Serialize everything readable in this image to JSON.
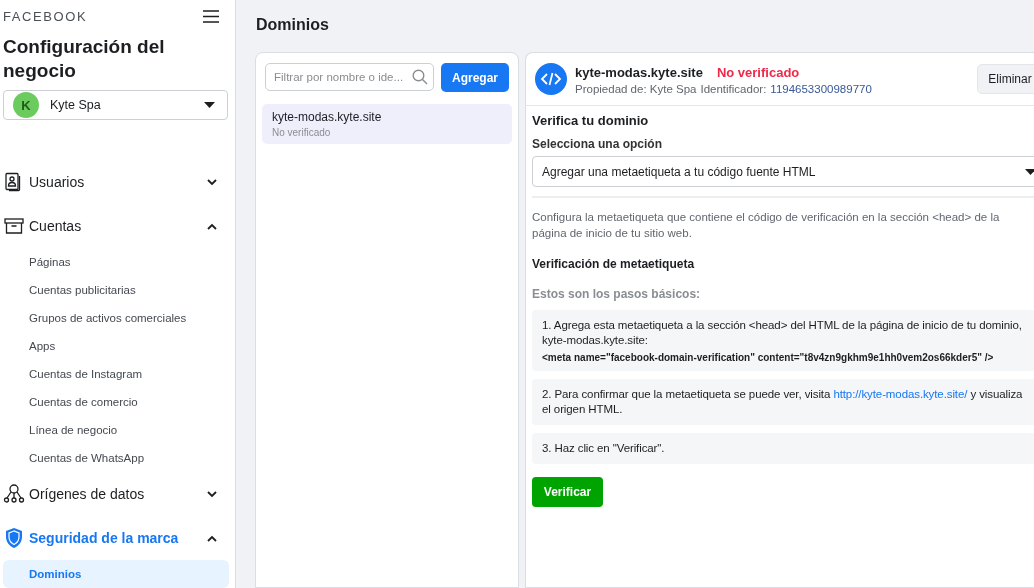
{
  "sidebar": {
    "brand": "FACEBOOK",
    "title": "Configuración del negocio",
    "business": {
      "initial": "K",
      "name": "Kyte Spa"
    },
    "sections": [
      {
        "label": "Usuarios",
        "expanded": false,
        "selected": false
      },
      {
        "label": "Cuentas",
        "expanded": true,
        "selected": false,
        "children": [
          {
            "label": "Páginas",
            "selected": false
          },
          {
            "label": "Cuentas publicitarias",
            "selected": false
          },
          {
            "label": "Grupos de activos comerciales",
            "selected": false
          },
          {
            "label": "Apps",
            "selected": false
          },
          {
            "label": "Cuentas de Instagram",
            "selected": false
          },
          {
            "label": "Cuentas de comercio",
            "selected": false
          },
          {
            "label": "Línea de negocio",
            "selected": false
          },
          {
            "label": "Cuentas de WhatsApp",
            "selected": false
          }
        ]
      },
      {
        "label": "Orígenes de datos",
        "expanded": false,
        "selected": false
      },
      {
        "label": "Seguridad de la marca",
        "expanded": true,
        "selected": true,
        "children": [
          {
            "label": "Dominios",
            "selected": true
          }
        ]
      }
    ]
  },
  "page_title": "Dominios",
  "domain_list": {
    "search": {
      "placeholder": "Filtrar por nombre o ide..."
    },
    "add_button": "Agregar",
    "items": [
      {
        "name": "kyte-modas.kyte.site",
        "status": "No verificado",
        "selected": true
      }
    ]
  },
  "detail": {
    "domain": "kyte-modas.kyte.site",
    "status": "No verificado",
    "verified": false,
    "owner": "Propiedad de: Kyte Spa",
    "id_label": "Identificador:",
    "id": "1194653300989770",
    "delete_button": "Eliminar",
    "heading": "Verifica tu dominio",
    "select_label": "Selecciona una opción",
    "select_value": "Agregar una metaetiqueta a tu código fuente HTML",
    "description": "Configura la metaetiqueta que contiene el código de verificación en la sección <head> de la página de inicio de tu sitio web.",
    "subheading": "Verificación de metaetiqueta",
    "steps_intro": "Estos son los pasos básicos:",
    "steps": [
      {
        "text": "1. Agrega esta metaetiqueta a la sección <head> del HTML de la página de inicio de tu dominio, kyte-modas.kyte.site:",
        "code": "<meta name=\"facebook-domain-verification\" content=\"t8v4zn9gkhm9e1hh0vem2os66kder5\" />"
      },
      {
        "text": "2. Para confirmar que la metaetiqueta se puede ver, visita",
        "link": "http://kyte-modas.kyte.site/",
        "text_after": "y visualiza el origen HTML."
      },
      {
        "text": "3. Haz clic en \"Verificar\"."
      }
    ],
    "verify_button": "Verificar"
  }
}
